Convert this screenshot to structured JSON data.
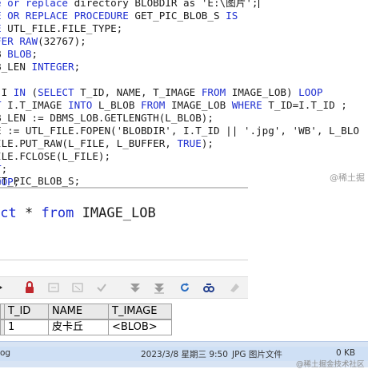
{
  "editor": {
    "lines": [
      {
        "kw1": "e or replace",
        "rest": " directory BLOBDIR as ",
        "str": "'E:\\图片'",
        "tail": ";"
      },
      {
        "kw1": "E OR REPLACE PROCEDURE",
        "rest": " GET_PIC_BLOB_S ",
        "kw2": "IS"
      },
      {
        "rest": "E UTL_FILE.FILE_TYPE;"
      },
      {
        "rest": "FER RAW(32767);"
      },
      {
        "rest": "B BLOB;"
      },
      {
        "rest": "B_LEN INTEGER;"
      },
      {
        "rest": ""
      },
      {
        "rest": " I IN (SELECT T_ID, NAME, T_IMAGE FROM IMAGE_LOB) LOOP"
      },
      {
        "rest": "T I.T_IMAGE INTO L_BLOB FROM IMAGE_LOB WHERE T_ID=I.T_ID ;"
      },
      {
        "rest": "B_LEN := DBMS_LOB.GETLENGTH(L_BLOB);"
      },
      {
        "rest": "E := UTL_FILE.FOPEN('BLOBDIR', I.T_ID || '.jpg', 'WB', L_BLO"
      },
      {
        "rest": "ILE.PUT_RAW(L_FILE, L_BUFFER, TRUE);"
      },
      {
        "rest": "ILE.FCLOSE(L_FILE);"
      },
      {
        "rest": "T;"
      },
      {
        "rest": "OOP;"
      },
      {
        "rest": "ET_PIC_BLOB_S;"
      }
    ],
    "watermark": "@稀土掘"
  },
  "query": {
    "kw_select": "ect",
    "star": " * ",
    "kw_from": "from",
    "table": " IMAGE_LOB"
  },
  "toolbar": {
    "icons": [
      "lock-icon",
      "new-record-icon",
      "delete-record-icon",
      "post-icon",
      "filter-icon",
      "sort-icon",
      "refresh-icon",
      "find-icon",
      "clear-icon"
    ]
  },
  "grid": {
    "headers": [
      "T_ID",
      "NAME",
      "T_IMAGE"
    ],
    "row": [
      "1",
      "皮卡丘",
      "<BLOB>"
    ]
  },
  "filebar": {
    "name": "og",
    "date": "2023/3/8 星期三 9:50",
    "type": "JPG 图片文件",
    "size": "0 KB",
    "watermark": "@稀土掘金技术社区"
  },
  "colors": {
    "keyword": "#1f2fd0",
    "selection": "#cfe0f5"
  }
}
